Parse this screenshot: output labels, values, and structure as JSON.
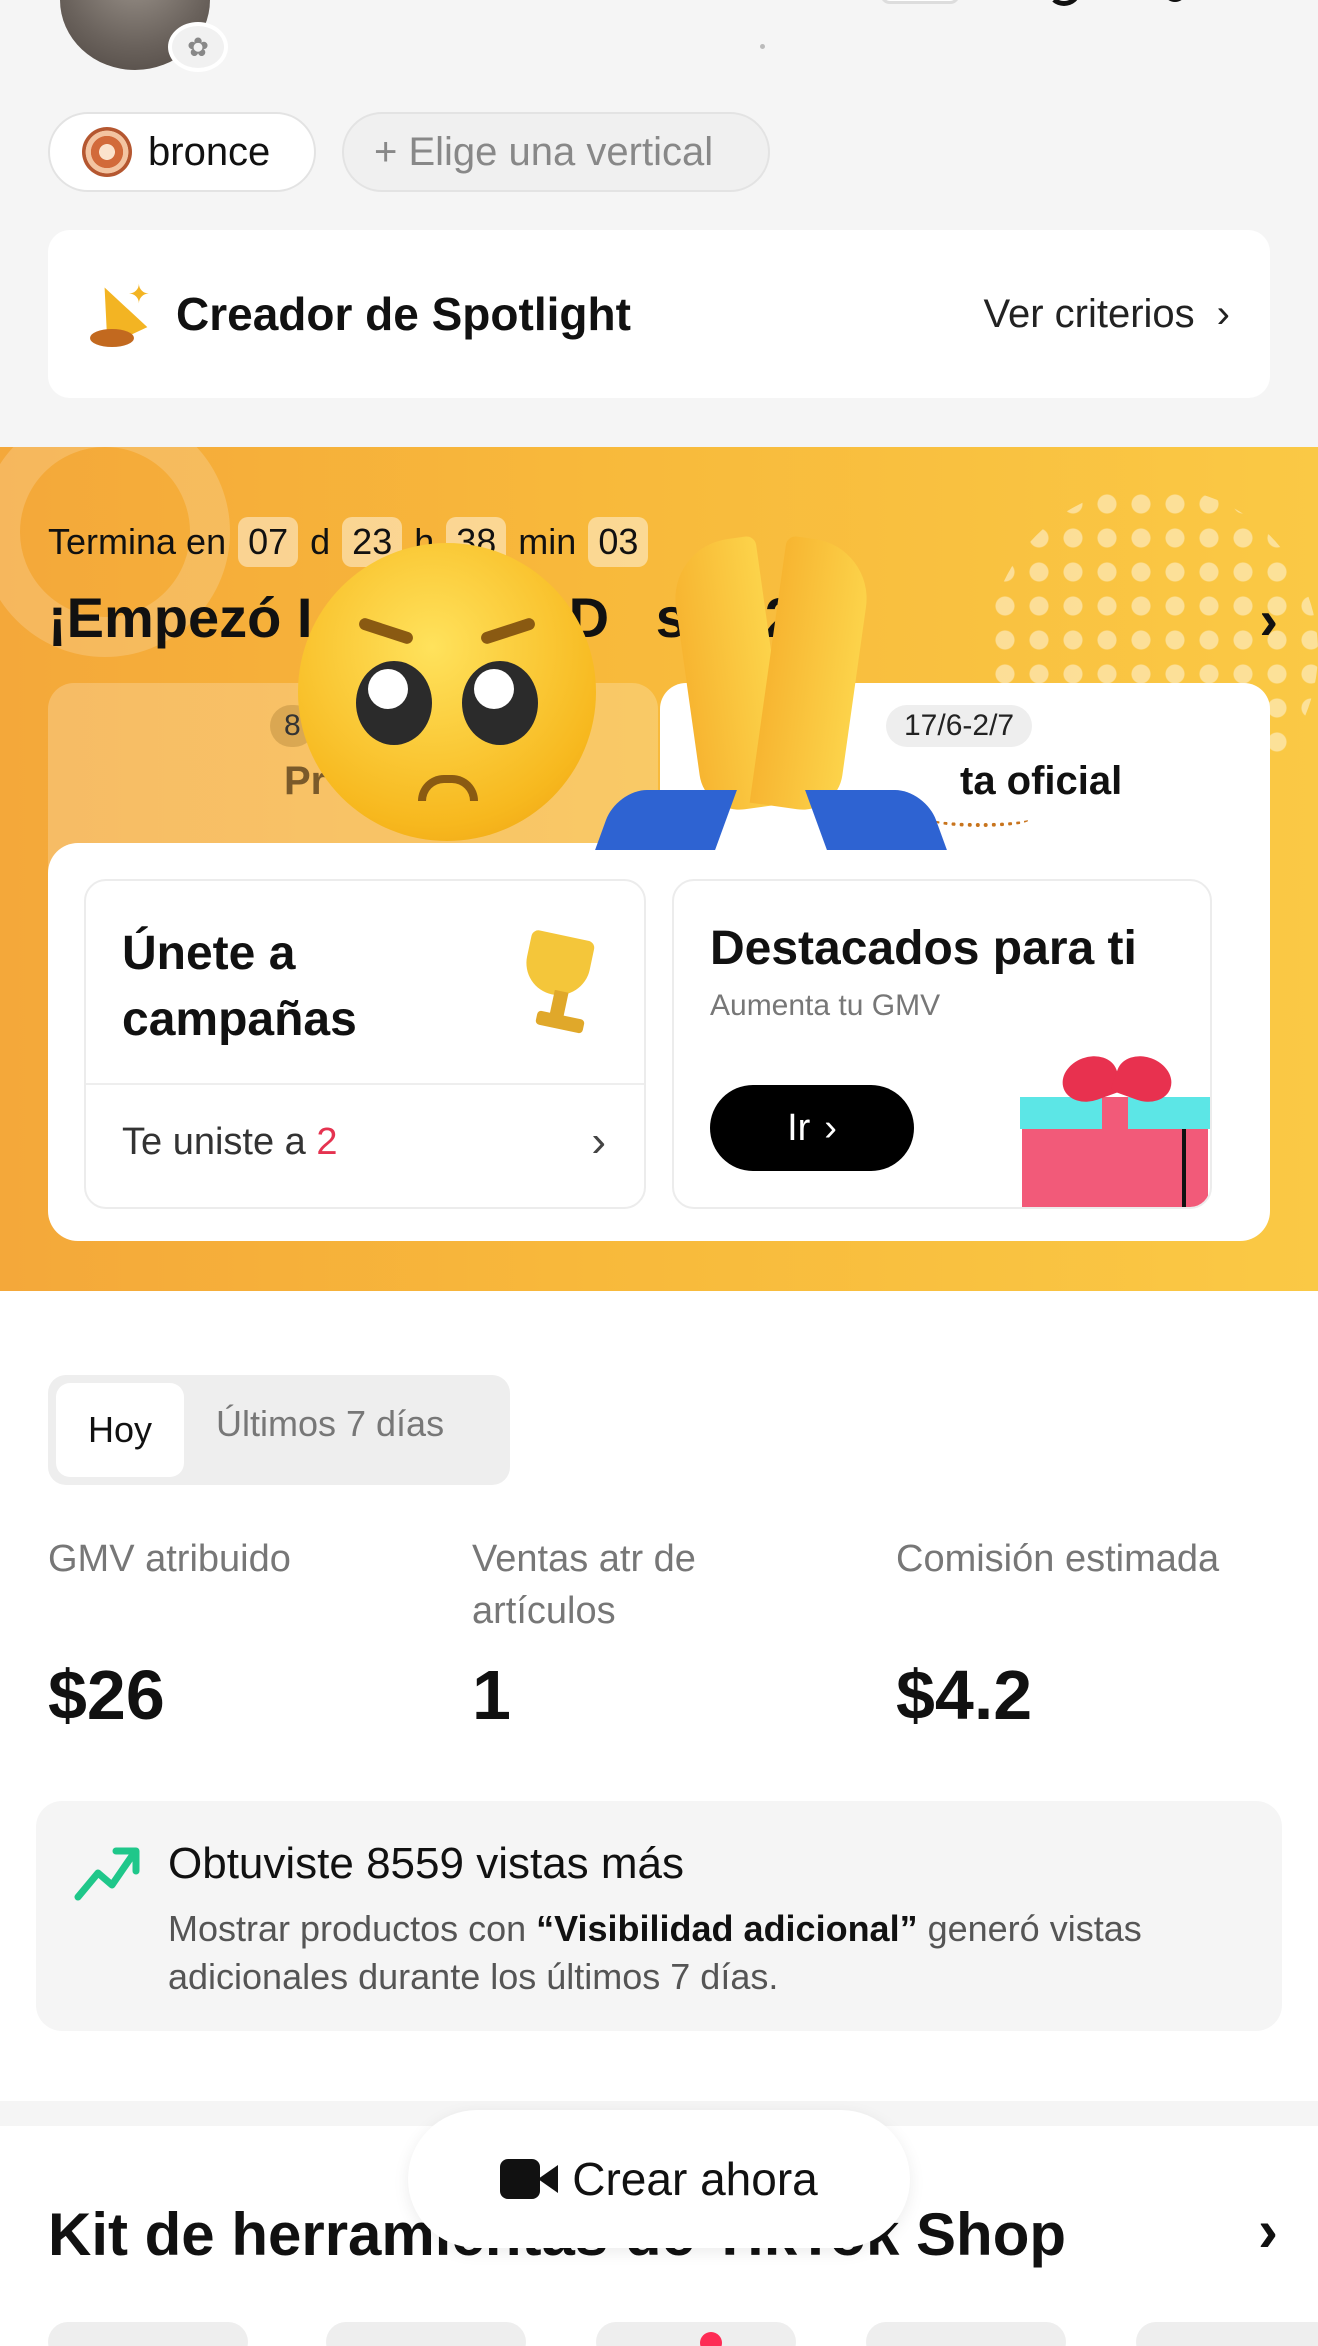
{
  "header": {
    "level_badge": "bronce",
    "vertical_pill": "+ Elige una vertical"
  },
  "spotlight": {
    "title": "Creador de Spotlight",
    "link": "Ver criterios"
  },
  "campaign": {
    "countdown_label": "Termina en",
    "days": "07",
    "days_unit": "d",
    "hours": "23",
    "hours_unit": "h",
    "minutes": "38",
    "minutes_unit": "min",
    "seconds": "03",
    "title": "¡Empezó I         You D   s 2026!",
    "tab_left_badge": "8",
    "tab_left_label": "Pr",
    "tab_right_badge": "17/6-2/7",
    "tab_right_label": "ta oficial",
    "join_card_title": "Únete a campañas",
    "join_card_footer_prefix": "Te uniste a ",
    "join_card_count": "2",
    "featured_title": "Destacados para ti",
    "featured_subtitle": "Aumenta tu GMV",
    "featured_button": "Ir"
  },
  "stats": {
    "tab_active": "Hoy",
    "tab_inactive": "Últimos 7 días",
    "metrics": [
      {
        "label": "GMV atribuido",
        "value": "$26"
      },
      {
        "label": "Ventas atr de artículos",
        "value": "1"
      },
      {
        "label": "Comisión estimada",
        "value": "$4.2"
      }
    ],
    "views_title": "Obtuviste 8559 vistas más",
    "views_text_prefix": "Mostrar productos con ",
    "views_text_bold": "“Visibilidad adicional”",
    "views_text_suffix": " generó vistas adicionales durante los últimos 7 días."
  },
  "toolkit": {
    "title": "Kit de herramientas de TikTok Shop",
    "create_button": "Crear ahora"
  },
  "colors": {
    "accent_red": "#fe2c55",
    "banner_orange": "#f4a83a",
    "banner_yellow": "#fac945",
    "trend_green": "#1fc78a"
  }
}
